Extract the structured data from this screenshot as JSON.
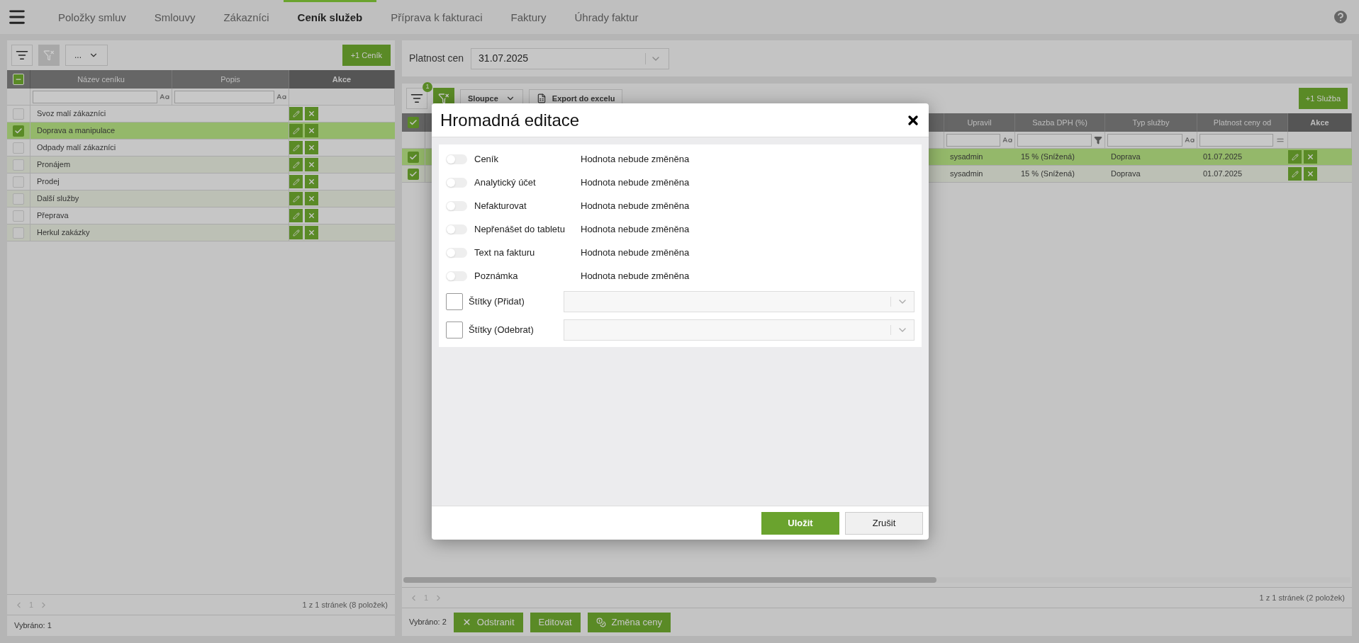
{
  "nav": {
    "tabs": [
      {
        "label": "Položky smluv",
        "selected": false
      },
      {
        "label": "Smlouvy",
        "selected": false
      },
      {
        "label": "Zákazníci",
        "selected": false
      },
      {
        "label": "Ceník služeb",
        "selected": true
      },
      {
        "label": "Příprava k fakturaci",
        "selected": false
      },
      {
        "label": "Faktury",
        "selected": false
      },
      {
        "label": "Úhrady faktur",
        "selected": false
      }
    ]
  },
  "left": {
    "toolbar": {
      "filter_active": false,
      "dropdown": "...",
      "add_button": "+1 Ceník"
    },
    "table": {
      "partially_checked": true,
      "columns": [
        {
          "label": "Název ceníku",
          "kind": "text"
        },
        {
          "label": "Popis",
          "kind": "text"
        },
        {
          "label": "Akce",
          "kind": "actions"
        }
      ],
      "rows": [
        {
          "name": "Svoz malí zákazníci",
          "selected": false
        },
        {
          "name": "Doprava a manipulace",
          "selected": true
        },
        {
          "name": "Odpady malí zákazníci",
          "selected": false
        },
        {
          "name": "Pronájem",
          "selected": false
        },
        {
          "name": "Prodej",
          "selected": false
        },
        {
          "name": "Další služby",
          "selected": false
        },
        {
          "name": "Přeprava",
          "selected": false
        },
        {
          "name": "Herkul zakázky",
          "selected": false
        }
      ]
    },
    "pager": {
      "page": "1",
      "summary": "1 z 1 stránek (8 položek)"
    },
    "selected_count": "Vybráno: 1"
  },
  "right": {
    "price_validity": {
      "label": "Platnost cen",
      "value": "31.07.2025"
    },
    "toolbar": {
      "filter_badge": "1",
      "filter_active": true,
      "columns_button": "Sloupce",
      "export_button": "Export do excelu",
      "add_button": "+1 Služba"
    },
    "table": {
      "all_checked": true,
      "columns": [
        {
          "label": "Upravil",
          "kind": "text"
        },
        {
          "label": "Sazba DPH (%)",
          "kind": "list"
        },
        {
          "label": "Typ služby",
          "kind": "text"
        },
        {
          "label": "Platnost ceny od",
          "kind": "equals"
        },
        {
          "label": "Akce",
          "kind": "actions"
        }
      ],
      "rows": [
        {
          "checked": true,
          "highlighted": true,
          "cells": [
            "sysadmin",
            "15 % (Snížená)",
            "Doprava",
            "01.07.2025"
          ]
        },
        {
          "checked": true,
          "highlighted": false,
          "cells": [
            "sysadmin",
            "15 % (Snížená)",
            "Doprava",
            "01.07.2025"
          ]
        }
      ]
    },
    "pager": {
      "page": "1",
      "summary": "1 z 1 stránek (2 položek)"
    },
    "selected_count": "Vybráno: 2",
    "actions": [
      {
        "kind": "delete",
        "label": "Odstranit"
      },
      {
        "kind": "edit",
        "label": "Editovat"
      },
      {
        "kind": "price",
        "label": "Změna ceny"
      }
    ]
  },
  "modal": {
    "title": "Hromadná editace",
    "fields": [
      {
        "kind": "toggle",
        "label": "Ceník",
        "on": false,
        "value": "Hodnota nebude změněna"
      },
      {
        "kind": "toggle",
        "label": "Analytický účet",
        "on": false,
        "value": "Hodnota nebude změněna"
      },
      {
        "kind": "toggle",
        "label": "Nefakturovat",
        "on": false,
        "value": "Hodnota nebude změněna"
      },
      {
        "kind": "toggle",
        "label": "Nepřenášet do tabletu",
        "on": false,
        "value": "Hodnota nebude změněna"
      },
      {
        "kind": "toggle",
        "label": "Text na fakturu",
        "on": false,
        "value": "Hodnota nebude změněna"
      },
      {
        "kind": "toggle",
        "label": "Poznámka",
        "on": false,
        "value": "Hodnota nebude změněna"
      },
      {
        "kind": "select",
        "label": "Štítky (Přidat)",
        "checked": false
      },
      {
        "kind": "select",
        "label": "Štítky (Odebrat)",
        "checked": false
      }
    ],
    "buttons": [
      {
        "kind": "primary",
        "label": "Uložit"
      },
      {
        "kind": "secondary",
        "label": "Zrušit"
      }
    ]
  }
}
